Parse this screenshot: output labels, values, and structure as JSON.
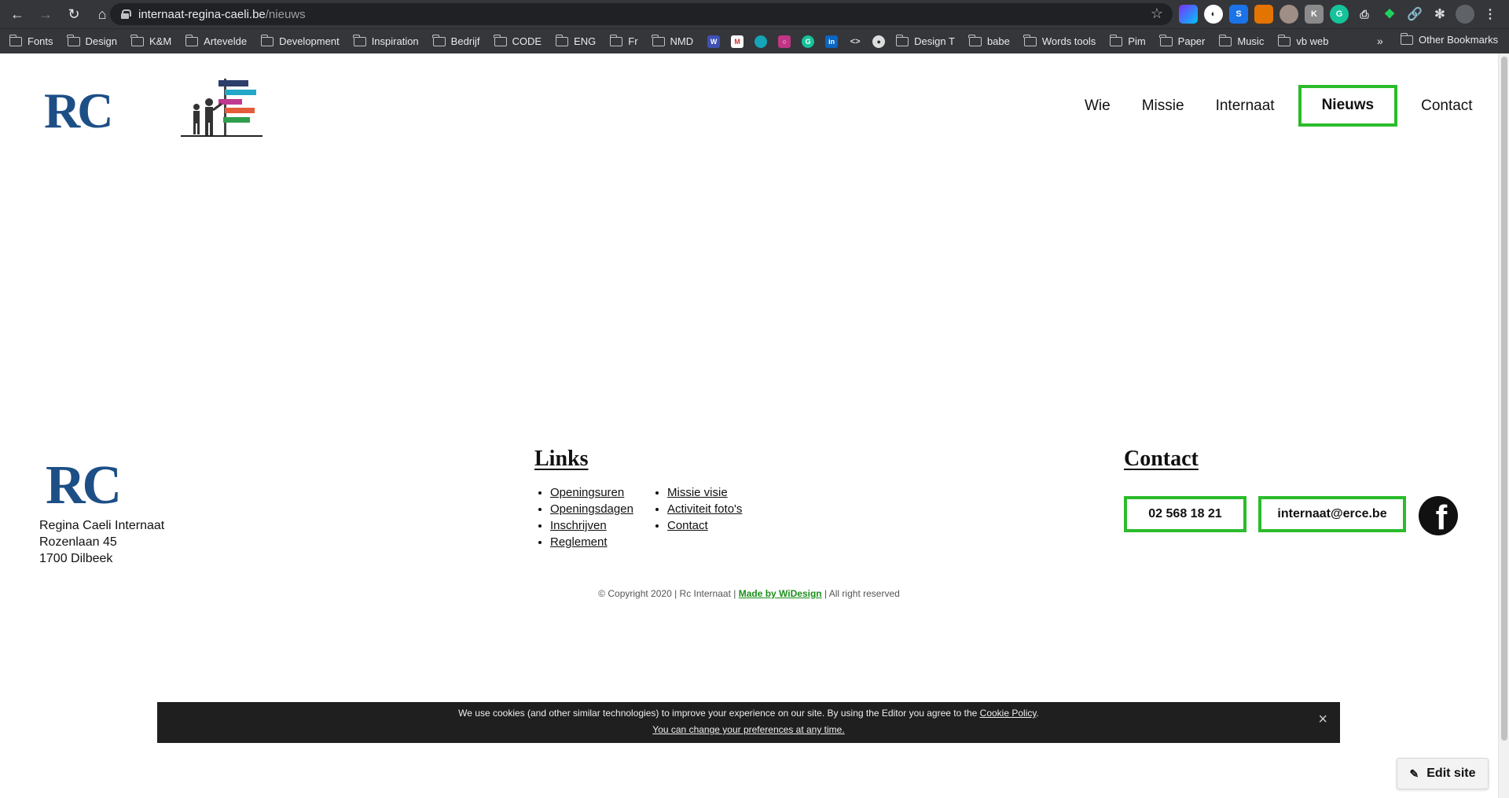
{
  "browser": {
    "url_host": "internaat-regina-caeli.be",
    "url_path": "/nieuws",
    "bookmarks": [
      "Fonts",
      "Design",
      "K&M",
      "Artevelde",
      "Development",
      "Inspiration",
      "Bedrijf",
      "CODE",
      "ENG",
      "Fr",
      "NMD"
    ],
    "bookmarks_2": [
      "Design T",
      "babe",
      "Words tools",
      "Pim",
      "Paper",
      "Music",
      "vb web"
    ],
    "other_bookmarks": "Other Bookmarks",
    "icon_colors": {
      "w": "#3f51b5",
      "gmail": "#d93025",
      "tiny": "#16a4b8",
      "insta": "#c13584",
      "grammarly": "#15c39a",
      "linkedin": "#0a66c2"
    }
  },
  "header": {
    "logo": "RC",
    "nav": {
      "wie": "Wie",
      "missie": "Missie",
      "internaat": "Internaat",
      "nieuws": "Nieuws",
      "contact": "Contact"
    }
  },
  "footer": {
    "logo": "RC",
    "address": [
      "Regina Caeli Internaat",
      "Rozenlaan 45",
      "1700 Dilbeek"
    ],
    "links_title": "Links",
    "links_col1": [
      "Openingsuren",
      "Openingsdagen",
      "Inschrijven",
      "Reglement"
    ],
    "links_col2": [
      "Missie visie",
      "Activiteit foto's",
      "Contact"
    ],
    "contact_title": "Contact",
    "phone": "02 568 18 21",
    "email": "internaat@erce.be",
    "copyright_pre": "© Copyright 2020 |  Rc Internaat |",
    "made_by": "Made by WiDesign",
    "copyright_post": "|  All right reserved"
  },
  "cookie": {
    "text": "We use cookies (and other similar technologies) to improve your experience on our site. By using the Editor you agree to the",
    "policy_link": "Cookie Policy",
    "period": ".",
    "prefs_link": "You can change your preferences at any time."
  },
  "edit_site": "Edit site",
  "colors": {
    "accent_green": "#2bbc2b",
    "logo_blue": "#1d4f86"
  }
}
